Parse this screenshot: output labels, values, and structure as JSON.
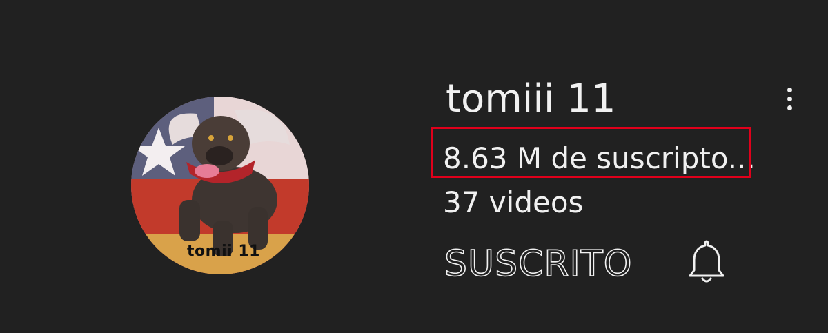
{
  "channel": {
    "name": "tomiii 11",
    "subscribers": "8.63 M de suscripto...",
    "videos": "37 videos",
    "avatar_caption": "tomii 11"
  },
  "actions": {
    "subscribe_label": "SUSCRITO",
    "more_icon": "more-vertical-icon",
    "bell_icon": "bell-icon"
  },
  "colors": {
    "background": "#212121",
    "text": "#f1f1f1",
    "highlight": "#e0001b"
  }
}
